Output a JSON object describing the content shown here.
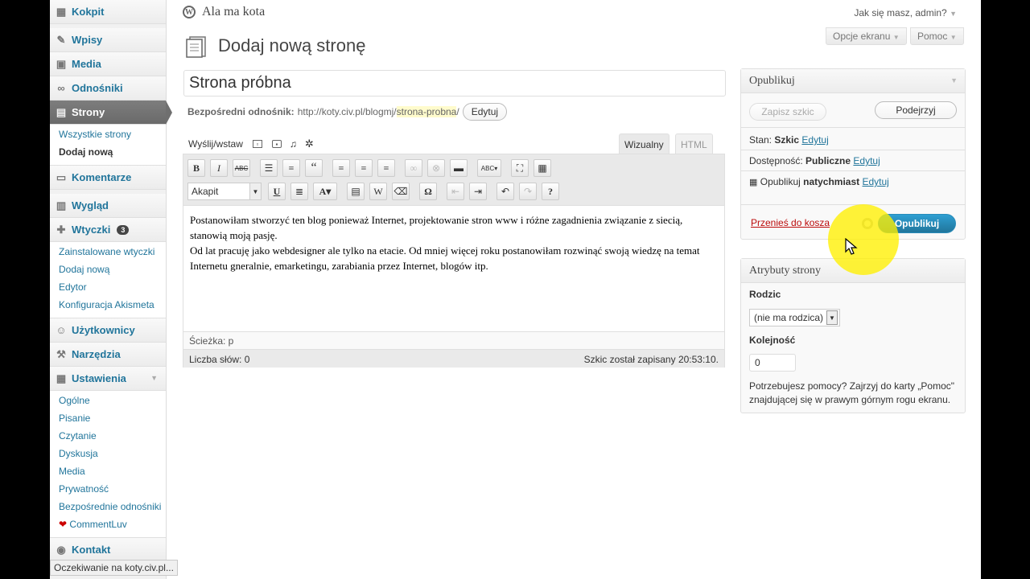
{
  "sidebar": {
    "items": [
      {
        "label": "Kokpit",
        "icon": "dashboard-icon"
      },
      {
        "label": "Wpisy",
        "icon": "pin-icon"
      },
      {
        "label": "Media",
        "icon": "media-icon"
      },
      {
        "label": "Odnośniki",
        "icon": "link-icon"
      },
      {
        "label": "Strony",
        "icon": "page-icon",
        "submenu": [
          "Wszystkie strony",
          "Dodaj nową"
        ]
      },
      {
        "label": "Komentarze",
        "icon": "comment-icon"
      },
      {
        "label": "Wygląd",
        "icon": "appearance-icon"
      },
      {
        "label": "Wtyczki",
        "icon": "plugin-icon",
        "badge": "3",
        "submenu": [
          "Zainstalowane wtyczki",
          "Dodaj nową",
          "Edytor",
          "Konfiguracja Akismeta"
        ]
      },
      {
        "label": "Użytkownicy",
        "icon": "users-icon"
      },
      {
        "label": "Narzędzia",
        "icon": "tools-icon"
      },
      {
        "label": "Ustawienia",
        "icon": "settings-icon",
        "submenu": [
          "Ogólne",
          "Pisanie",
          "Czytanie",
          "Dyskusja",
          "Media",
          "Prywatność",
          "Bezpośrednie odnośniki",
          "CommentLuv"
        ]
      },
      {
        "label": "Kontakt",
        "icon": "contact-icon"
      }
    ]
  },
  "header": {
    "site_title": "Ala ma kota",
    "howdy": "Jak się masz, admin?",
    "screen_options": "Opcje ekranu",
    "help": "Pomoc"
  },
  "page": {
    "heading": "Dodaj nową stronę",
    "title_value": "Strona próbna",
    "permalink_label": "Bezpośredni odnośnik:",
    "permalink_base": "http://koty.civ.pl/blogmj/",
    "permalink_slug": "strona-probna",
    "permalink_suffix": "/",
    "edit_button": "Edytuj"
  },
  "editor": {
    "upload_label": "Wyślij/wstaw",
    "tab_visual": "Wizualny",
    "tab_html": "HTML",
    "format": "Akapit",
    "content_p1": "Postanowiłam stworzyć ten blog ponieważ Internet, projektowanie stron www i różne zagadnienia związanie z siecią, stanowią moją pasję.",
    "content_p2": "Od lat pracuję jako webdesigner ale tylko na etacie. Od mniej więcej roku postanowiłam rozwinąć swoją wiedzę na temat Internetu gneralnie, emarketingu, zarabiania przez Internet, blogów itp.",
    "path": "Ścieżka: p",
    "word_count": "Liczba słów: 0",
    "draft_saved": "Szkic został zapisany 20:53:10."
  },
  "publish": {
    "title": "Opublikuj",
    "save_draft": "Zapisz szkic",
    "preview": "Podejrzyj",
    "status_label": "Stan:",
    "status_value": "Szkic",
    "visibility_label": "Dostępność:",
    "visibility_value": "Publiczne",
    "publish_label": "Opublikuj",
    "publish_value": "natychmiast",
    "edit": "Edytuj",
    "trash": "Przenieś do kosza",
    "publish_button": "Opublikuj"
  },
  "attributes": {
    "title": "Atrybuty strony",
    "parent_label": "Rodzic",
    "parent_value": "(nie ma rodzica)",
    "order_label": "Kolejność",
    "order_value": "0",
    "help": "Potrzebujesz pomocy? Zajrzyj do karty „Pomoc\" znajdującej się w prawym górnym rogu ekranu."
  },
  "statusbar": "Oczekiwanie na koty.civ.pl...",
  "colors": {
    "link": "#21759b",
    "publish": "#21759b",
    "trash": "#bc0b0b",
    "highlight": "#fff000"
  }
}
